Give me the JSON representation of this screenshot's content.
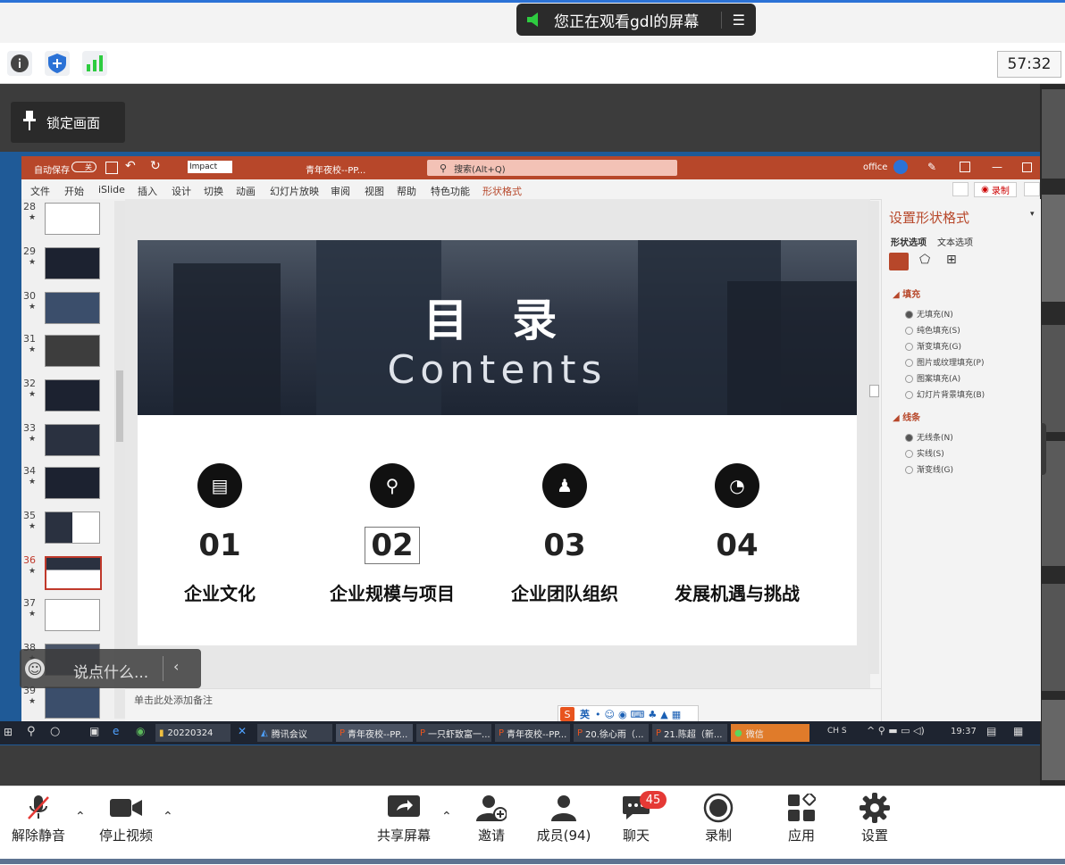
{
  "screen_share": {
    "banner_text": "您正在观看gdl的屏幕"
  },
  "toolbar": {
    "timer": "57:32"
  },
  "lock_screen": {
    "label": "锁定画面"
  },
  "ppt": {
    "autosave": "自动保存",
    "autosave_state": "关",
    "font": "Impact",
    "doc_title": "青年夜校--PP...",
    "search_placeholder": "搜索(Alt+Q)",
    "account": "office",
    "menu": [
      "文件",
      "开始",
      "iSlide",
      "插入",
      "设计",
      "切换",
      "动画",
      "幻灯片放映",
      "审阅",
      "视图",
      "帮助",
      "特色功能",
      "形状格式"
    ],
    "record_label": "录制",
    "slide_numbers": [
      "28",
      "29",
      "30",
      "31",
      "32",
      "33",
      "34",
      "35",
      "36",
      "37",
      "38",
      "39"
    ],
    "notes_placeholder": "单击此处添加备注"
  },
  "slide": {
    "title": "目 录",
    "subtitle": "Contents",
    "items": [
      {
        "num": "01",
        "label": "企业文化"
      },
      {
        "num": "02",
        "label": "企业规模与项目"
      },
      {
        "num": "03",
        "label": "企业团队组织"
      },
      {
        "num": "04",
        "label": "发展机遇与挑战"
      }
    ]
  },
  "format_pane": {
    "title": "设置形状格式",
    "tabs": [
      "形状选项",
      "文本选项"
    ],
    "fill_header": "填充",
    "fill_options": [
      "无填充(N)",
      "纯色填充(S)",
      "渐变填充(G)",
      "图片或纹理填充(P)",
      "图案填充(A)",
      "幻灯片背景填充(B)"
    ],
    "line_header": "线条",
    "line_options": [
      "无线条(N)",
      "实线(S)",
      "渐变线(G)"
    ]
  },
  "taskbar": {
    "tasks": [
      "20220324",
      "腾讯会议",
      "青年夜校--PP...",
      "一只虾致富一...",
      "青年夜校--PP...",
      "20.徐心雨（...",
      "21.陈超（新...",
      "微信"
    ],
    "time": "19:37",
    "ime": "英"
  },
  "chat_input": {
    "placeholder": "说点什么..."
  },
  "meeting_bar": {
    "unmute": "解除静音",
    "stop_video": "停止视频",
    "share": "共享屏幕",
    "invite": "邀请",
    "members": "成员(94)",
    "chat": "聊天",
    "chat_badge": "45",
    "record": "录制",
    "apps": "应用",
    "settings": "设置"
  },
  "colors": {
    "ppt_accent": "#b7472a",
    "meeting_bg": "#ffffff",
    "badge": "#e53935"
  }
}
